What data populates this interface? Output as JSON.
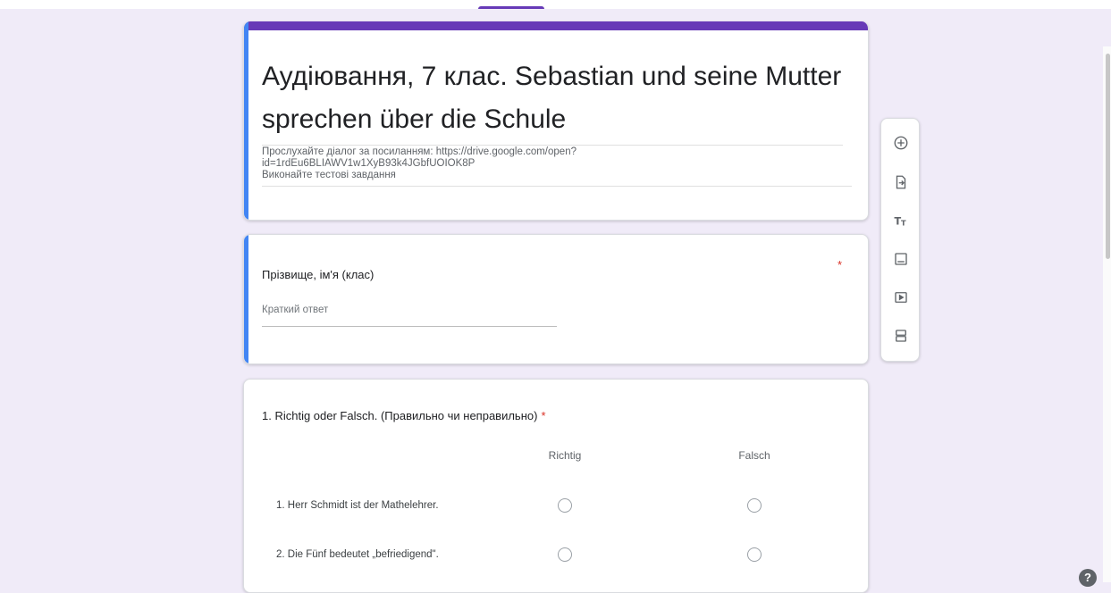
{
  "form": {
    "title": "Аудіювання, 7 клас. Sebastian und seine Mutter sprechen über die Schule",
    "description_lines": [
      "Прослухайте діалог за посиланням: https://drive.google.com/open?",
      "id=1rdEu6BLIAWV1w1XyB93k4JGbfUOIOK8P",
      "Виконайте тестові завдання"
    ]
  },
  "questions": [
    {
      "title": "Прізвище, ім'я (клас)",
      "required_mark": "*",
      "placeholder": "Краткий ответ"
    },
    {
      "title": "1. Richtig oder Falsch. (Правильно чи неправильно)",
      "required_mark": "*",
      "columns": [
        "Richtig",
        "Falsch"
      ],
      "rows": [
        "1. Herr Schmidt ist der Mathelehrer.",
        "2. Die Fünf bedeutet „befriedigend\"."
      ]
    }
  ],
  "toolbar": {
    "items": [
      "add-question",
      "import-questions",
      "add-title",
      "add-image",
      "add-video",
      "add-section"
    ]
  },
  "help_label": "?",
  "colors": {
    "accent": "#673ab7",
    "focus": "#4285f4",
    "background": "#f0ebf8",
    "required": "#d93025"
  }
}
